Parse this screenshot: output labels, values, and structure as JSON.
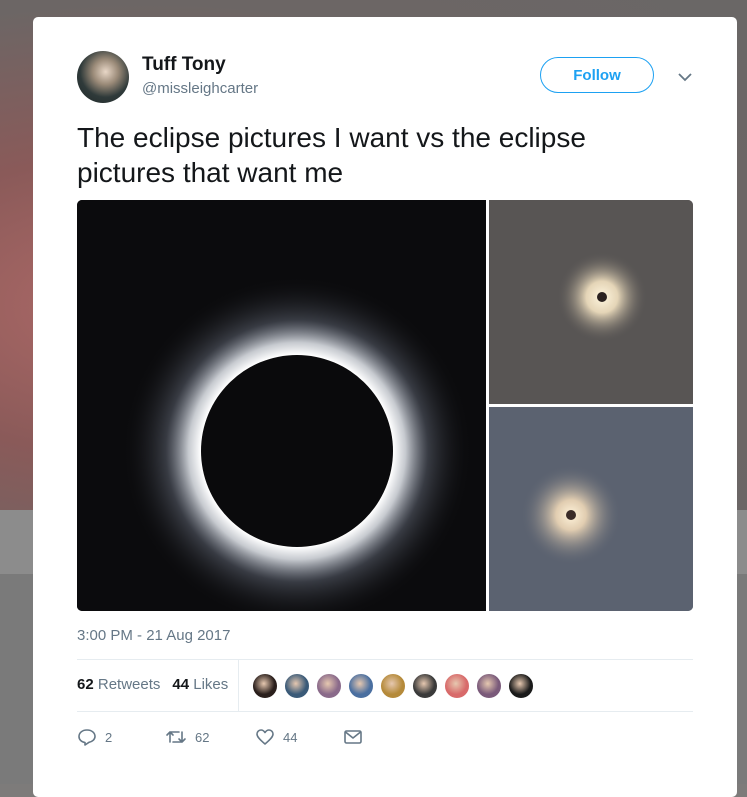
{
  "tweet": {
    "author_name": "Tuff Tony",
    "author_handle": "@missleighcarter",
    "follow_label": "Follow",
    "text": "The eclipse pictures I want vs the eclipse pictures that want me",
    "timestamp": "3:00 PM - 21 Aug 2017",
    "retweets_count": "62",
    "retweets_label": "Retweets",
    "likes_count": "44",
    "likes_label": "Likes",
    "liker_avatars": [
      "#2a1f1c",
      "#3a5a78",
      "#8a6a8a",
      "#4a6fa0",
      "#b58a3a",
      "#3a3a3a",
      "#d86a6a",
      "#7a5a7a",
      "#1a1a1a"
    ],
    "reply_count": "2",
    "retweet_action_count": "62",
    "like_action_count": "44"
  },
  "colors": {
    "accent": "#1da1f2",
    "secondary_text": "#657786",
    "primary_text": "#14171a"
  },
  "icons": [
    "chevron-down-icon",
    "reply-icon",
    "retweet-icon",
    "heart-icon",
    "envelope-icon"
  ]
}
